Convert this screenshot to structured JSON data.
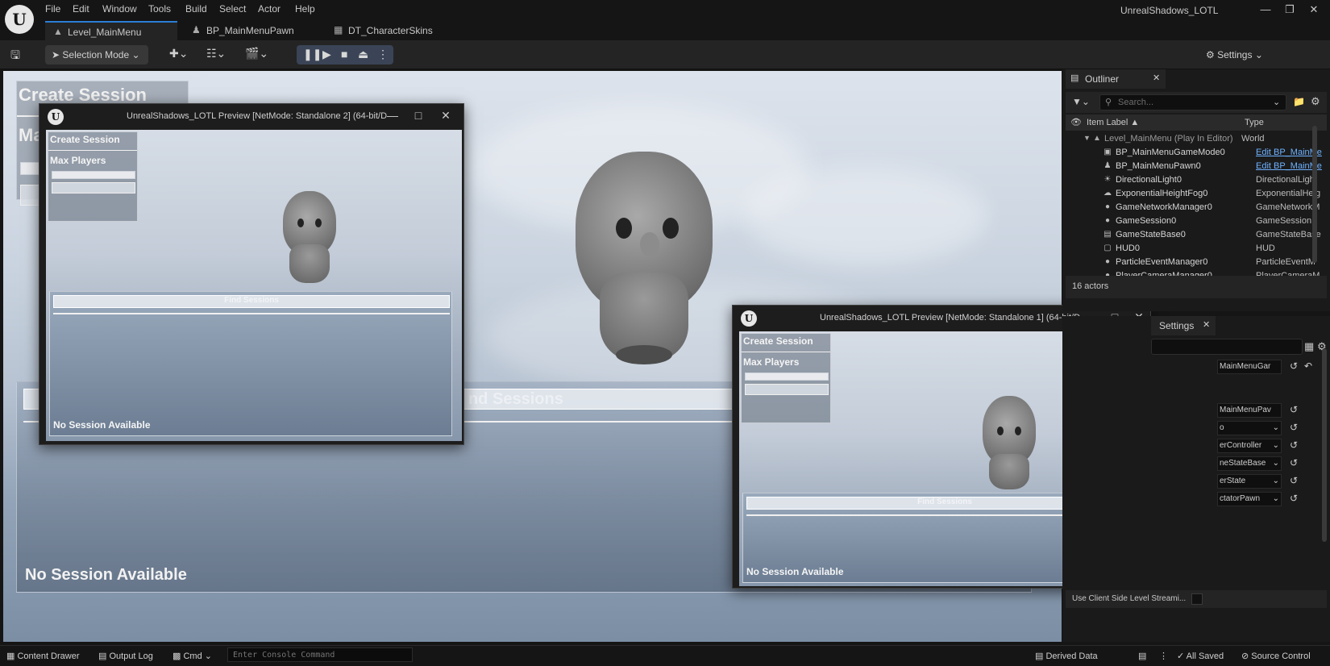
{
  "menu": [
    "File",
    "Edit",
    "Window",
    "Tools",
    "Build",
    "Select",
    "Actor",
    "Help"
  ],
  "app_title": "UnrealShadows_LOTL",
  "tabs": [
    {
      "label": "Level_MainMenu",
      "icon": "level-icon",
      "active": true
    },
    {
      "label": "BP_MainMenuPawn",
      "icon": "pawn-icon",
      "active": false
    },
    {
      "label": "DT_CharacterSkins",
      "icon": "datatable-icon",
      "active": false
    }
  ],
  "toolbar": {
    "selection_mode": "Selection Mode",
    "settings": "Settings"
  },
  "viewport": {
    "create_session": "Create Session",
    "max_players_partial": "Ma",
    "find_sessions_partial": "nd Sessions",
    "no_session": "No Session Available"
  },
  "pie_left": {
    "title": "UnrealShadows_LOTL Preview [NetMode: Standalone 2]  (64-bit/D",
    "create_session": "Create Session",
    "max_players": "Max Players",
    "find_sessions": "Find Sessions",
    "no_session": "No Session Available"
  },
  "pie_right": {
    "title": "UnrealShadows_LOTL Preview [NetMode: Standalone 1]  (64-bit/D",
    "create_session": "Create Session",
    "max_players": "Max Players",
    "find_sessions": "Find Sessions",
    "no_session": "No Session Available"
  },
  "outliner": {
    "tab": "Outliner",
    "search_placeholder": "Search...",
    "col_label": "Item Label ▲",
    "col_type": "Type",
    "root": {
      "label": "Level_MainMenu (Play In Editor)",
      "type": "World"
    },
    "rows": [
      {
        "label": "BP_MainMenuGameMode0",
        "type": "Edit BP_MainMe",
        "link": true,
        "icon": "gamemode-icon",
        "glyph": "▣"
      },
      {
        "label": "BP_MainMenuPawn0",
        "type": "Edit BP_MainMe",
        "link": true,
        "icon": "pawn-icon",
        "glyph": "♟"
      },
      {
        "label": "DirectionalLight0",
        "type": "DirectionalLight",
        "link": false,
        "icon": "directional-light-icon",
        "glyph": "☀"
      },
      {
        "label": "ExponentialHeightFog0",
        "type": "ExponentialHeig",
        "link": false,
        "icon": "fog-icon",
        "glyph": "☁"
      },
      {
        "label": "GameNetworkManager0",
        "type": "GameNetworkM",
        "link": false,
        "icon": "actor-icon",
        "glyph": "●"
      },
      {
        "label": "GameSession0",
        "type": "GameSession",
        "link": false,
        "icon": "actor-icon",
        "glyph": "●"
      },
      {
        "label": "GameStateBase0",
        "type": "GameStateBase",
        "link": false,
        "icon": "gamestate-icon",
        "glyph": "▤"
      },
      {
        "label": "HUD0",
        "type": "HUD",
        "link": false,
        "icon": "hud-icon",
        "glyph": "▢"
      },
      {
        "label": "ParticleEventManager0",
        "type": "ParticleEventM",
        "link": false,
        "icon": "actor-icon",
        "glyph": "●"
      },
      {
        "label": "PlayerCameraManager0",
        "type": "PlayerCameraM",
        "link": false,
        "icon": "actor-icon",
        "glyph": "●"
      }
    ],
    "count": "16 actors"
  },
  "details": {
    "tab": "Settings",
    "fields": [
      "MainMenuGar",
      "MainMenuPav",
      "o",
      "erController",
      "neStateBase",
      "erState",
      "ctatorPawn"
    ],
    "bottom_label": "Use Client Side Level Streami..."
  },
  "statusbar": {
    "content_drawer": "Content Drawer",
    "output_log": "Output Log",
    "cmd": "Cmd",
    "console_placeholder": "Enter Console Command",
    "derived_data": "Derived Data",
    "all_saved": "All Saved",
    "source_control": "Source Control"
  }
}
